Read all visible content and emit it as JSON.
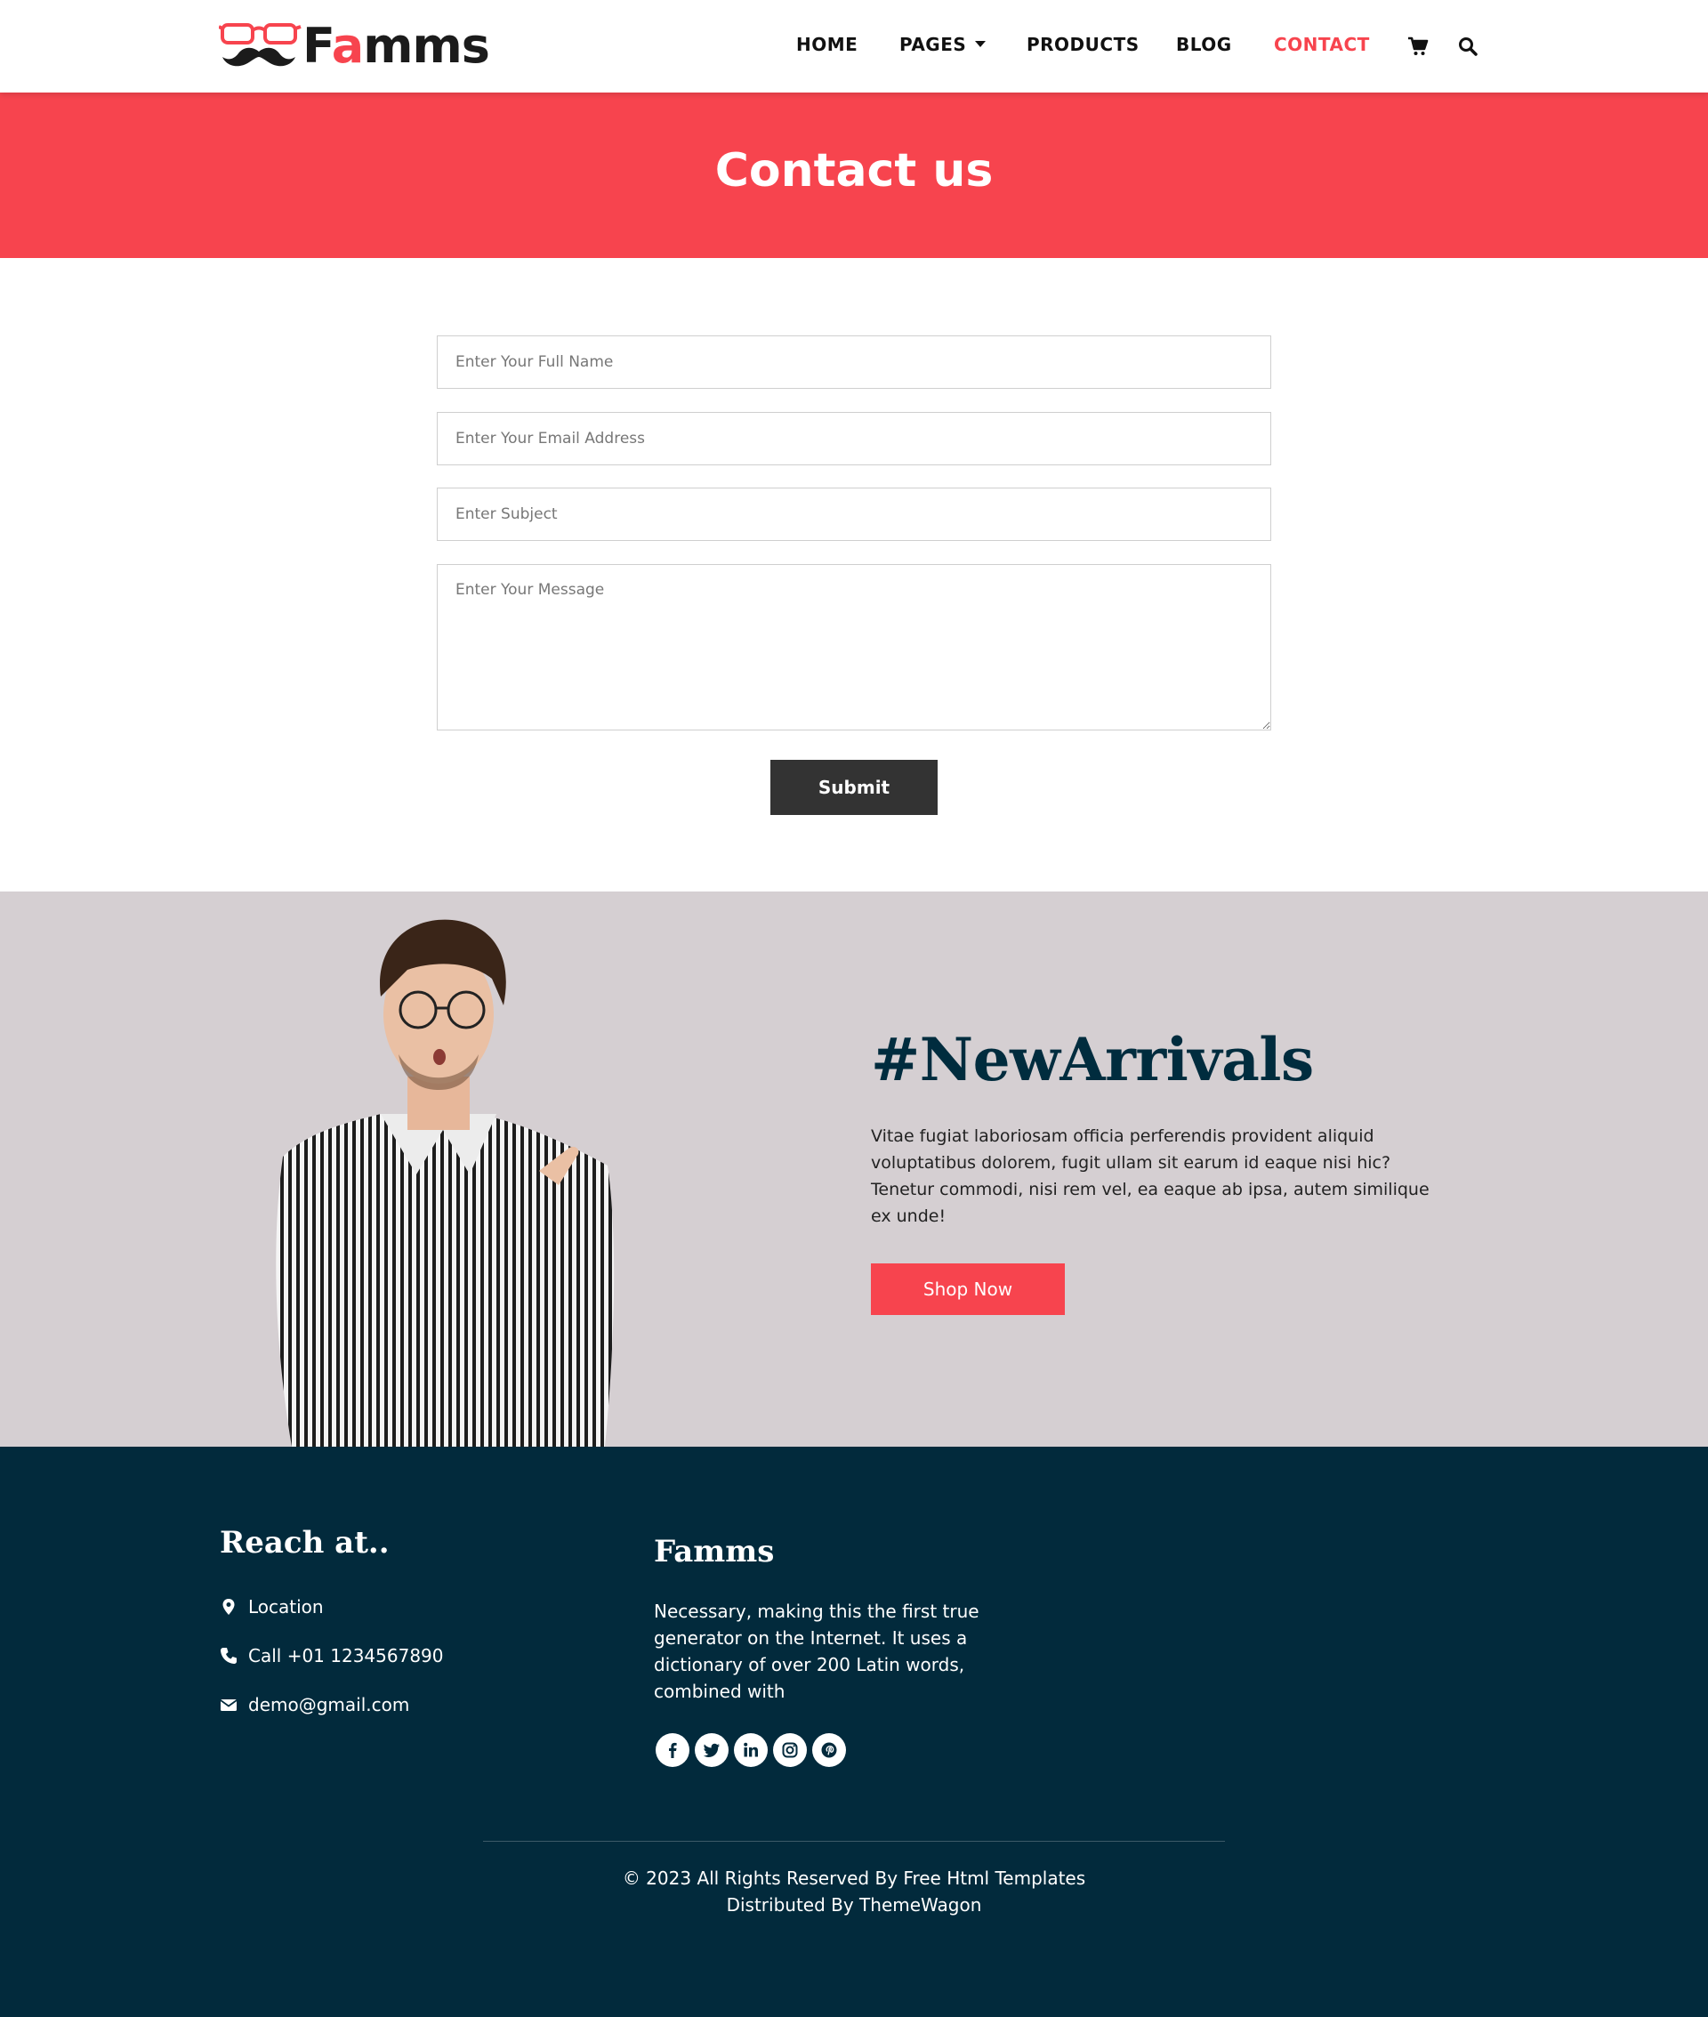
{
  "brand": {
    "name_prefix": "F",
    "name_accent": "a",
    "name_suffix": "mms",
    "accent_color": "#f7444e",
    "dark_color": "#002c3e"
  },
  "nav": {
    "items": [
      {
        "label": "HOME",
        "active": false
      },
      {
        "label": "PAGES",
        "active": false,
        "dropdown": true
      },
      {
        "label": "PRODUCTS",
        "active": false
      },
      {
        "label": "BLOG",
        "active": false
      },
      {
        "label": "CONTACT",
        "active": true
      }
    ],
    "icons": [
      "cart-icon",
      "search-icon"
    ]
  },
  "hero": {
    "title": "Contact us"
  },
  "form": {
    "full_name_placeholder": "Enter Your Full Name",
    "email_placeholder": "Enter Your Email Address",
    "subject_placeholder": "Enter Subject",
    "message_placeholder": "Enter Your Message",
    "submit_label": "Submit"
  },
  "arrival": {
    "title": "#NewArrivals",
    "text": "Vitae fugiat laboriosam officia perferendis provident aliquid voluptatibus dolorem, fugit ullam sit earum id eaque nisi hic? Tenetur commodi, nisi rem vel, ea eaque ab ipsa, autem similique ex unde!",
    "button_label": "Shop Now",
    "background": "#d5cfd2"
  },
  "footer": {
    "reach_title": "Reach at..",
    "location": "Location",
    "phone": "Call +01 1234567890",
    "email": "demo@gmail.com",
    "brand_title": "Famms",
    "brand_text": "Necessary, making this the first true generator on the Internet. It uses a dictionary of over 200 Latin words, combined with",
    "socials": [
      "facebook-icon",
      "twitter-icon",
      "linkedin-icon",
      "instagram-icon",
      "pinterest-icon"
    ],
    "copyright_line1": "© 2023 All Rights Reserved By Free Html Templates",
    "copyright_line2": "Distributed By ThemeWagon",
    "background": "#022a3c"
  }
}
